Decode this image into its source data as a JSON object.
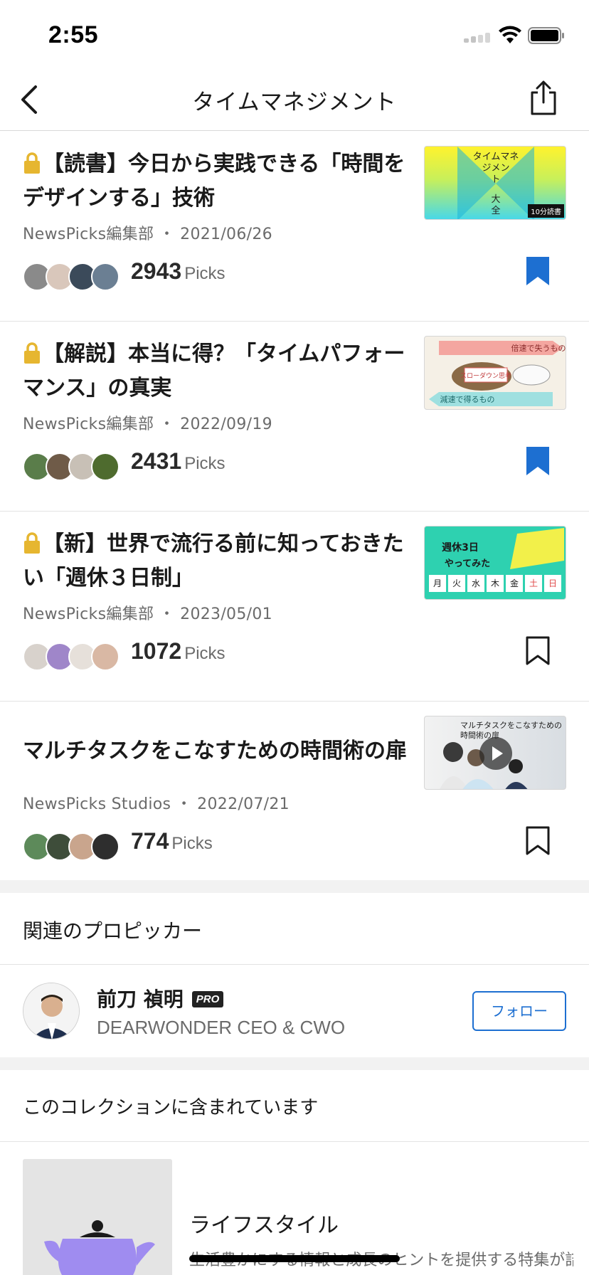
{
  "status_bar": {
    "time": "2:55"
  },
  "nav": {
    "title": "タイムマネジメント"
  },
  "articles": [
    {
      "locked": true,
      "title": "【読書】今日から実践できる「時間をデザインする」技術",
      "source": "NewsPicks編集部",
      "date": "2021/06/26",
      "picks": "2943",
      "picks_label": "Picks",
      "bookmarked": true,
      "thumb_text": "タイムマネジメント大全",
      "thumb_badge": "10分読書"
    },
    {
      "locked": true,
      "title": "【解説】本当に得？「タイムパフォーマンス」の真実",
      "source": "NewsPicks編集部",
      "date": "2022/09/19",
      "picks": "2431",
      "picks_label": "Picks",
      "bookmarked": true,
      "thumb_text_top": "倍速で失うもの",
      "thumb_text_bottom": "減速で得るもの",
      "thumb_text_mid": "スローダウン思考"
    },
    {
      "locked": true,
      "title": "【新】世界で流行る前に知っておきたい「週休３日制」",
      "source": "NewsPicks編集部",
      "date": "2023/05/01",
      "picks": "1072",
      "picks_label": "Picks",
      "bookmarked": false,
      "thumb_text": "週休3日 やってみた",
      "thumb_days": [
        "月",
        "火",
        "水",
        "木",
        "金",
        "土",
        "日"
      ]
    },
    {
      "locked": false,
      "title": "マルチタスクをこなすための時間術の扉",
      "source": "NewsPicks Studios",
      "date": "2022/07/21",
      "picks": "774",
      "picks_label": "Picks",
      "bookmarked": false,
      "thumb_text": "マルチタスクをこなすための時間術の扉"
    }
  ],
  "related": {
    "header": "関連のプロピッカー",
    "picker_name": "前刀 禎明",
    "badge": "PRO",
    "picker_title": "DEARWONDER CEO & CWO",
    "follow_label": "フォロー"
  },
  "collection": {
    "header": "このコレクションに含まれています",
    "title": "ライフスタイル",
    "description": "生活豊かにする情報と成長のヒントを提供する特集が詰"
  },
  "colors": {
    "accent": "#1d6fd1",
    "lock": "#e6b630",
    "separator": "#e3e3e3"
  }
}
